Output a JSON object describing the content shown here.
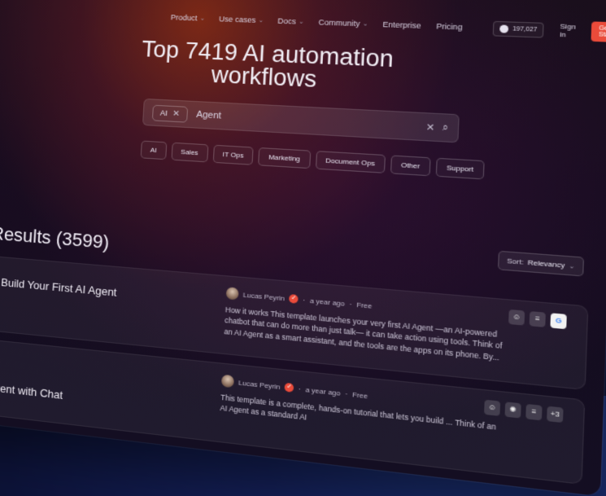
{
  "nav": {
    "items": [
      {
        "label": "Product",
        "dropdown": true
      },
      {
        "label": "Use cases",
        "dropdown": true
      },
      {
        "label": "Docs",
        "dropdown": true
      },
      {
        "label": "Community",
        "dropdown": true
      },
      {
        "label": "Enterprise",
        "dropdown": false
      },
      {
        "label": "Pricing",
        "dropdown": false
      }
    ],
    "github_stars": "197,027",
    "signin": "Sign in",
    "get_started": "Get Started"
  },
  "hero": {
    "title_line1": "Top 7419 AI automation",
    "title_line2": "workflows"
  },
  "search": {
    "chip": "AI",
    "query": "Agent"
  },
  "filters": [
    "AI",
    "Sales",
    "IT Ops",
    "Marketing",
    "Document Ops",
    "Other",
    "Support"
  ],
  "sort": {
    "label": "Sort:",
    "value": "Relevancy"
  },
  "results": {
    "title": "Results (3599)",
    "cards": [
      {
        "title": "Build Your First AI Agent",
        "author": "Lucas Peyrin",
        "time": "a year ago",
        "price": "Free",
        "desc": "How it works This template launches your very first AI Agent —an AI-powered chatbot that can do more than just talk— it can take action using tools. Think of an AI Agent as a smart assistant, and the tools are the apps on its phone. By...",
        "nodes": [
          "robot-icon",
          "db-icon",
          "google-icon"
        ],
        "extra": ""
      },
      {
        "title": "gent with Chat",
        "author": "Lucas Peyrin",
        "time": "a year ago",
        "price": "Free",
        "desc": "This template is a complete, hands-on tutorial that lets you build ... Think of an AI Agent as a standard AI",
        "nodes": [
          "robot-icon",
          "openai-icon",
          "db-icon"
        ],
        "extra": "+3"
      }
    ]
  },
  "colors": {
    "accent": "#ea4b3a",
    "page_bg": "#0c1238"
  }
}
